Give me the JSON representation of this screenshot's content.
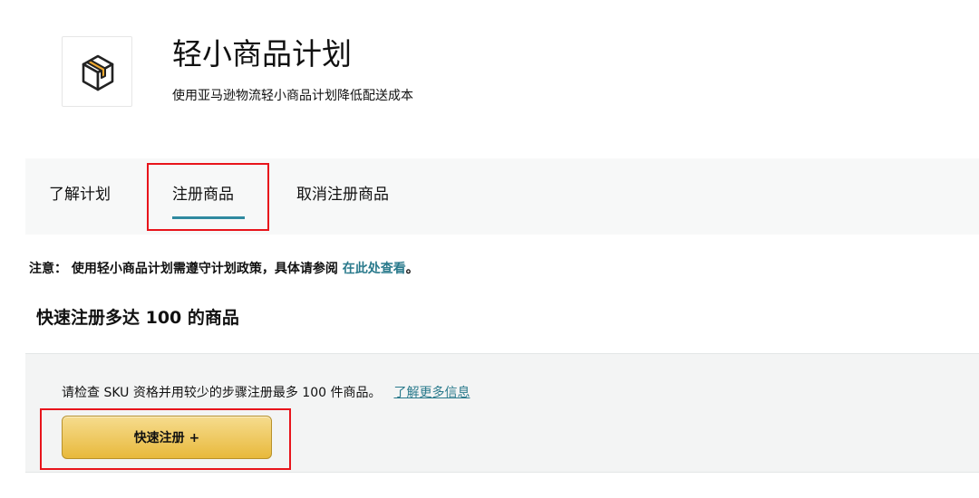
{
  "header": {
    "title": "轻小商品计划",
    "subtitle": "使用亚马逊物流轻小商品计划降低配送成本",
    "logo_icon": "package-box-icon"
  },
  "tabs": [
    {
      "label": "了解计划",
      "active": false
    },
    {
      "label": "注册商品",
      "active": true
    },
    {
      "label": "取消注册商品",
      "active": false
    }
  ],
  "notice": {
    "text": "注意：  使用轻小商品计划需遵守计划政策，具体请参阅 ",
    "link_label": "在此处查看",
    "suffix": "。"
  },
  "quick_register": {
    "heading": "快速注册多达 100 的商品",
    "description": "请检查 SKU 资格并用较少的步骤注册最多 100 件商品。",
    "learn_more_label": "了解更多信息",
    "button_label": "快速注册 +"
  },
  "colors": {
    "link": "#2a7a8c",
    "active_tab_underline": "#2f8aa0",
    "annotation_box": "#e8141b",
    "button_top": "#f6dc8e",
    "button_bottom": "#e8b93c",
    "icon_accent": "#f0a92e"
  }
}
